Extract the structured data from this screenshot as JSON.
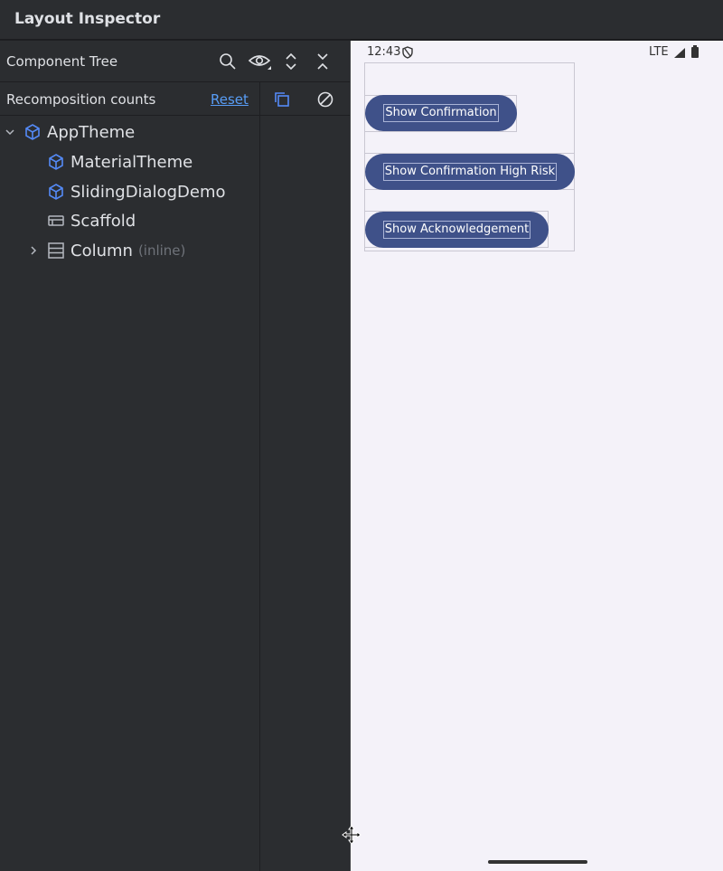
{
  "window": {
    "title": "Layout Inspector"
  },
  "component_tree": {
    "title": "Component Tree",
    "toolbar_icons": [
      "search-icon",
      "eye-icon",
      "expand-all-icon",
      "collapse-all-icon"
    ]
  },
  "recomposition": {
    "label": "Recomposition counts",
    "reset_label": "Reset",
    "icons": [
      "copy-icon",
      "disable-icon"
    ]
  },
  "tree": [
    {
      "label": "AppTheme",
      "icon": "compose-cube-icon",
      "expandable": true,
      "expanded": true,
      "suffix": ""
    },
    {
      "label": "MaterialTheme",
      "icon": "compose-cube-icon",
      "expandable": false,
      "expanded": false,
      "suffix": ""
    },
    {
      "label": "SlidingDialogDemo",
      "icon": "compose-cube-icon",
      "expandable": false,
      "expanded": false,
      "suffix": ""
    },
    {
      "label": "Scaffold",
      "icon": "scaffold-icon",
      "expandable": false,
      "expanded": false,
      "suffix": ""
    },
    {
      "label": "Column",
      "icon": "column-icon",
      "expandable": true,
      "expanded": false,
      "suffix": "(inline)"
    }
  ],
  "device": {
    "status_time": "12:43",
    "status_network": "LTE",
    "buttons": [
      {
        "label": "Show Confirmation"
      },
      {
        "label": "Show Confirmation High Risk"
      },
      {
        "label": "Show Acknowledgement"
      }
    ]
  },
  "colors": {
    "accent_link": "#589df6",
    "button_fill": "#3f5189",
    "icon_blue": "#548af7"
  }
}
